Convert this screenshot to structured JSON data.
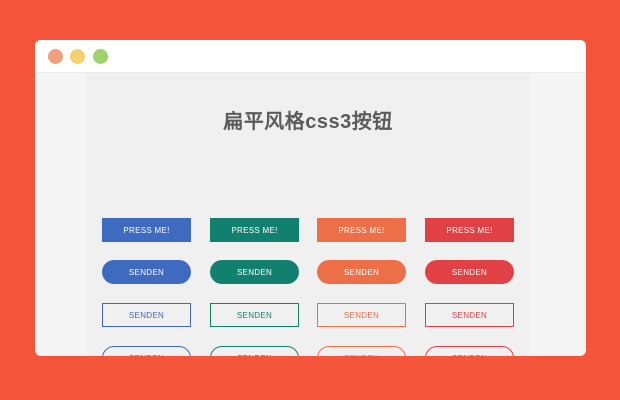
{
  "page": {
    "title": "扁平风格css3按钮"
  },
  "colors": {
    "background": "#f4553a",
    "blue": "#3e6ac0",
    "teal": "#12806f",
    "orange": "#ed6f48",
    "red": "#e14044"
  },
  "window": {
    "controls": [
      "close-dot",
      "minimize-dot",
      "maximize-dot"
    ]
  },
  "buttons": {
    "row1": [
      "PRESS ME!",
      "PRESS ME!",
      "PRESS ME!",
      "PRESS ME!"
    ],
    "row2": [
      "SENDEN",
      "SENDEN",
      "SENDEN",
      "SENDEN"
    ],
    "row3": [
      "SENDEN",
      "SENDEN",
      "SENDEN",
      "SENDEN"
    ],
    "row4": [
      "SENDEN",
      "SENDEN",
      "SENDEN",
      "SENDEN"
    ]
  }
}
